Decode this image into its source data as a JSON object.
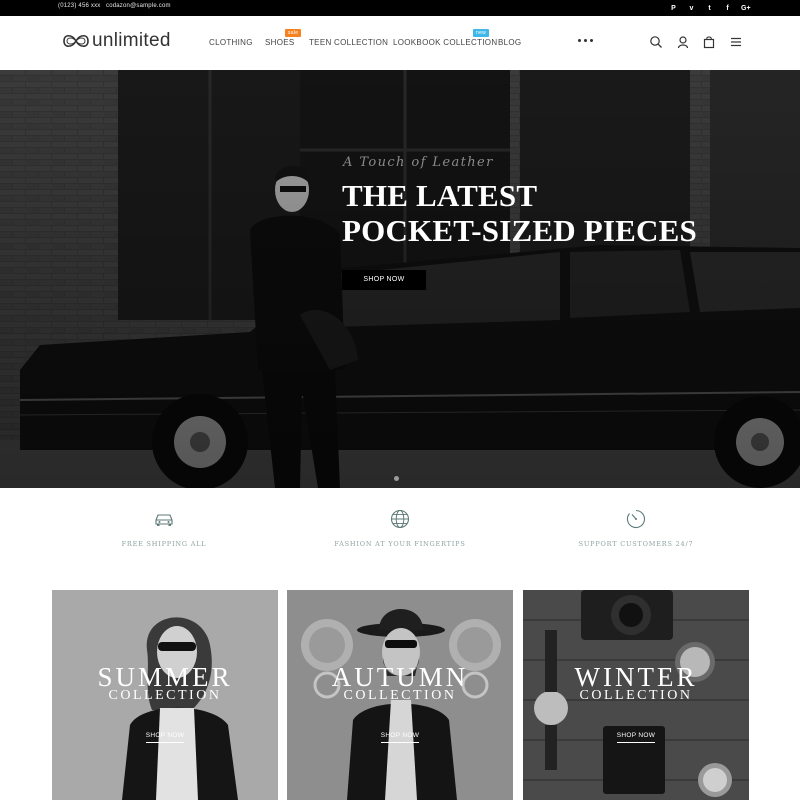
{
  "topbar": {
    "phone": "(0123) 456 xxx",
    "email": "codazon@sample.com",
    "social": [
      {
        "icon": "pinterest-icon",
        "glyph": "P"
      },
      {
        "icon": "vimeo-icon",
        "glyph": "v"
      },
      {
        "icon": "twitter-icon",
        "glyph": "t"
      },
      {
        "icon": "facebook-icon",
        "glyph": "f"
      },
      {
        "icon": "google-plus-icon",
        "glyph": "G+"
      }
    ]
  },
  "header": {
    "logo_text": "unlimited",
    "nav": [
      {
        "label": "CLOTHING"
      },
      {
        "label": "SHOES",
        "badge": "sale"
      },
      {
        "label": "TEEN COLLECTION"
      },
      {
        "label": "LOOKBOOK COLLECTION",
        "badge": "new"
      },
      {
        "label": "BLOG"
      }
    ],
    "icons": [
      "search-icon",
      "user-icon",
      "cart-icon",
      "menu-icon"
    ]
  },
  "hero": {
    "subtitle": "A Touch of Leather",
    "title_line1": "THE LATEST",
    "title_line2": "POCKET-SIZED PIECES",
    "cta": "SHOP NOW"
  },
  "features": [
    {
      "icon": "car-icon",
      "label": "FREE SHIPPING ALL"
    },
    {
      "icon": "globe-icon",
      "label": "FASHION AT YOUR FINGERTIPS"
    },
    {
      "icon": "clock-icon",
      "label": "SUPPORT CUSTOMERS 24/7"
    }
  ],
  "collections": [
    {
      "season": "SUMMER",
      "label": "COLLECTION",
      "cta": "SHOP NOW"
    },
    {
      "season": "AUTUMN",
      "label": "COLLECTION",
      "cta": "SHOP NOW"
    },
    {
      "season": "WINTER",
      "label": "COLLECTION",
      "cta": "SHOP NOW"
    }
  ],
  "colors": {
    "topbar_bg": "#000000",
    "sale_badge": "#f58220",
    "new_badge": "#3fb7e8",
    "feature_text": "#8fa3a3"
  }
}
